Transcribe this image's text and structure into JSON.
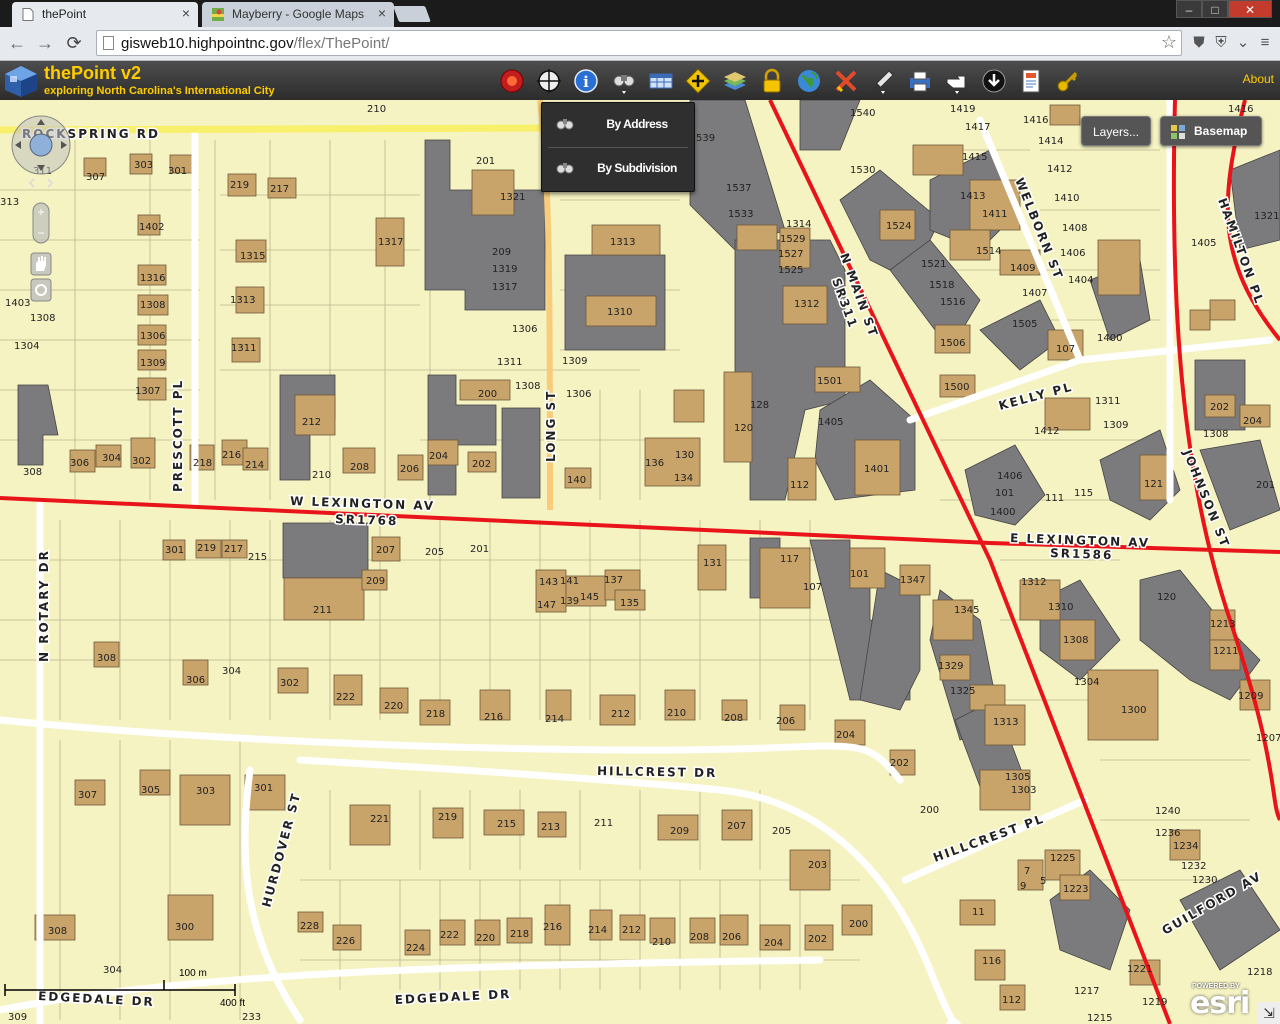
{
  "browser": {
    "tabs": [
      {
        "title": "thePoint",
        "icon": "page-icon",
        "active": true
      },
      {
        "title": "Mayberry - Google Maps",
        "icon": "google-maps-icon",
        "active": false
      }
    ],
    "close_glyph": "×",
    "url_host": "gisweb10.highpointnc.gov",
    "url_path": "/flex/ThePoint/",
    "window_buttons": {
      "minimize": "–",
      "maximize": "□",
      "close": "✕"
    },
    "nav": {
      "back": "←",
      "forward": "→",
      "reload": "⟳"
    },
    "star": "☆",
    "extensions": [
      "⛊",
      "⛨",
      "⌄",
      "≡"
    ]
  },
  "app": {
    "title": "thePoint v2",
    "subtitle": "exploring North Carolina's International City",
    "about_label": "About",
    "tools": [
      "record-icon",
      "crosshair-icon",
      "info-icon",
      "binoculars-icon",
      "table-icon",
      "plus-marker-icon",
      "layers-icon",
      "lock-icon",
      "globe-icon",
      "draw-tools-icon",
      "pencil-icon",
      "print-icon",
      "hand-point-icon",
      "download-icon",
      "report-icon",
      "key-icon"
    ],
    "colors": {
      "accent": "#ffcc00",
      "header": "#3a3a3a"
    }
  },
  "search_menu": {
    "items": [
      {
        "label": "By Address",
        "icon": "binoculars-icon"
      },
      {
        "label": "By Subdivision",
        "icon": "binoculars-icon"
      }
    ]
  },
  "map": {
    "layers_label": "Layers...",
    "basemap_label": "Basemap",
    "scale_m": "100 m",
    "scale_ft": "400 ft",
    "powered_by": "POWERED BY",
    "esri": "esri",
    "streets": [
      "ROCKSPRING RD",
      "W LEXINGTON AV",
      "SR1768",
      "E LEXINGTON AV",
      "SR1586",
      "N MAIN ST",
      "SR311",
      "LONG ST",
      "PRESCOTT PL",
      "N ROTARY DR",
      "HILLCREST DR",
      "HILLCREST PL",
      "HURDOVER ST",
      "EDGEDALE DR",
      "WELBORN ST",
      "HAMILTON PL",
      "KELLY PL",
      "JOHNSON ST",
      "GUILFORD AV"
    ],
    "parcel_numbers": [
      "210",
      "1540",
      "1419",
      "1417",
      "1416",
      "1416",
      "1414",
      "1415",
      "1412",
      "1400",
      "311",
      "303",
      "301",
      "307",
      "313",
      "219",
      "217",
      "201",
      "1321",
      "539",
      "1537",
      "1533",
      "1530",
      "1524",
      "1413",
      "1411",
      "1410",
      "1408",
      "1406",
      "1404",
      "1402",
      "1317",
      "209",
      "1319",
      "1317",
      "1313",
      "1314",
      "1529",
      "1527",
      "1525",
      "1521",
      "1518",
      "1516",
      "1514",
      "1409",
      "1407",
      "1405",
      "1321",
      "1316",
      "1315",
      "1310",
      "1312",
      "1505",
      "1403",
      "1308",
      "1308",
      "1313",
      "1306",
      "1311",
      "1306",
      "1309",
      "1304",
      "1311",
      "1309",
      "1308",
      "1307",
      "1306",
      "1506",
      "107",
      "1500",
      "1501",
      "200",
      "212",
      "128",
      "1405",
      "120",
      "1412",
      "1311",
      "1309",
      "1308",
      "202",
      "204",
      "136",
      "130",
      "1401",
      "308",
      "306",
      "304",
      "302",
      "218",
      "216",
      "214",
      "210",
      "208",
      "206",
      "204",
      "202",
      "140",
      "134",
      "112",
      "1406",
      "101",
      "111",
      "115",
      "121",
      "201",
      "1400",
      "301",
      "219",
      "217",
      "215",
      "207",
      "205",
      "201",
      "143",
      "141",
      "137",
      "131",
      "117",
      "107",
      "101",
      "1347",
      "1312",
      "1310",
      "120",
      "1213",
      "147",
      "139",
      "145",
      "135",
      "209",
      "211",
      "1345",
      "1308",
      "1211",
      "308",
      "306",
      "304",
      "302",
      "222",
      "220",
      "218",
      "216",
      "214",
      "212",
      "210",
      "208",
      "206",
      "1329",
      "1304",
      "1325",
      "1209",
      "1300",
      "204",
      "202",
      "1313",
      "1207",
      "307",
      "305",
      "303",
      "301",
      "221",
      "219",
      "215",
      "213",
      "211",
      "209",
      "207",
      "205",
      "1305",
      "1303",
      "200",
      "1240",
      "1236",
      "1234",
      "1232",
      "1230",
      "203",
      "1225",
      "7",
      "5",
      "9",
      "1223",
      "308",
      "300",
      "228",
      "226",
      "224",
      "222",
      "220",
      "218",
      "216",
      "214",
      "212",
      "210",
      "208",
      "206",
      "204",
      "202",
      "200",
      "11",
      "304",
      "116",
      "1221",
      "112",
      "1217",
      "1219",
      "1218",
      "309",
      "233",
      "1215"
    ]
  }
}
